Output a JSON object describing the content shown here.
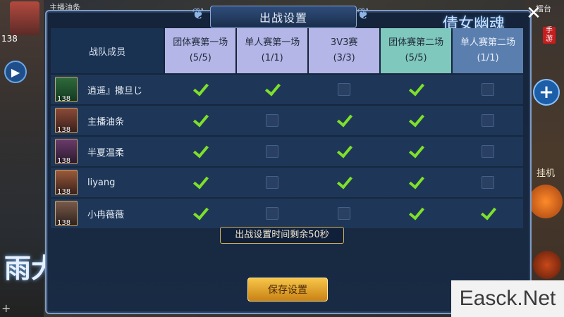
{
  "dialog": {
    "title": "出战设置",
    "close_glyph": "✕",
    "brand_logo": "倩女幽魂",
    "brand_tag": "手游"
  },
  "hud": {
    "top_text": "主播油条",
    "top_right_text": "擂台",
    "player_level": "138",
    "auto_label": "挂机",
    "calligraphy": "雨大"
  },
  "table": {
    "member_header": "战队成员",
    "matches": [
      {
        "name": "团体赛第一场",
        "count": "(5/5)",
        "style": "purple"
      },
      {
        "name": "单人赛第一场",
        "count": "(1/1)",
        "style": "purple"
      },
      {
        "name": "3V3赛",
        "count": "(3/3)",
        "style": "purple"
      },
      {
        "name": "团体赛第二场",
        "count": "(5/5)",
        "style": "teal"
      },
      {
        "name": "单人赛第二场",
        "count": "(1/1)",
        "style": "blue"
      }
    ],
    "members": [
      {
        "name": "逍遥』撒旦じ",
        "level": "138",
        "checks": [
          true,
          true,
          false,
          true,
          false
        ]
      },
      {
        "name": "主播油条",
        "level": "138",
        "checks": [
          true,
          false,
          true,
          true,
          false
        ]
      },
      {
        "name": "半夏温柔",
        "level": "138",
        "checks": [
          true,
          false,
          true,
          true,
          false
        ]
      },
      {
        "name": "liyang",
        "level": "138",
        "checks": [
          true,
          false,
          true,
          true,
          false
        ]
      },
      {
        "name": "小冉薇薇",
        "level": "138",
        "checks": [
          true,
          false,
          false,
          true,
          true
        ]
      }
    ]
  },
  "timer_text": "出战设置时间剩余50秒",
  "save_label": "保存设置",
  "watermark": "Easck.Net",
  "colors": {
    "check_green": "#7ee02a",
    "header_purple": "#b3b6e6",
    "header_teal": "#7fc8bd",
    "header_blue": "#5a7faf",
    "save_gold": "#f0b43a"
  }
}
